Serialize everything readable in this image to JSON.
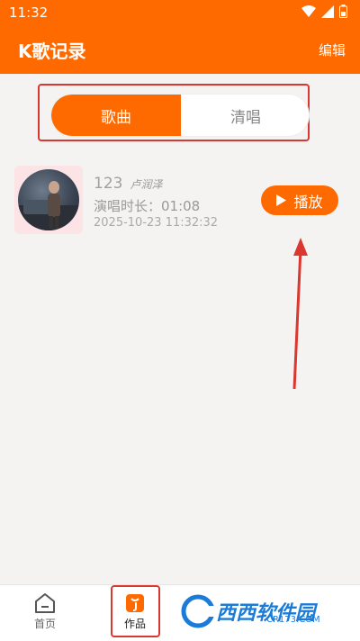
{
  "status_bar": {
    "time": "11:32"
  },
  "app_bar": {
    "title": "K歌记录",
    "edit_label": "编辑"
  },
  "segment": {
    "tab_songs": "歌曲",
    "tab_acapella": "清唱",
    "active": "歌曲"
  },
  "records": [
    {
      "song": "123",
      "singer": "卢润泽",
      "duration": "演唱时长：01:08",
      "timestamp": "2025-10-23 11:32:32",
      "play_label": "播放"
    }
  ],
  "bottom_nav": {
    "home": "首页",
    "works": "作品"
  },
  "watermark": {
    "text": "西西软件园",
    "sub": "CR173.COM"
  },
  "colors": {
    "accent": "#ff6a00",
    "annotation": "#d9372f"
  }
}
